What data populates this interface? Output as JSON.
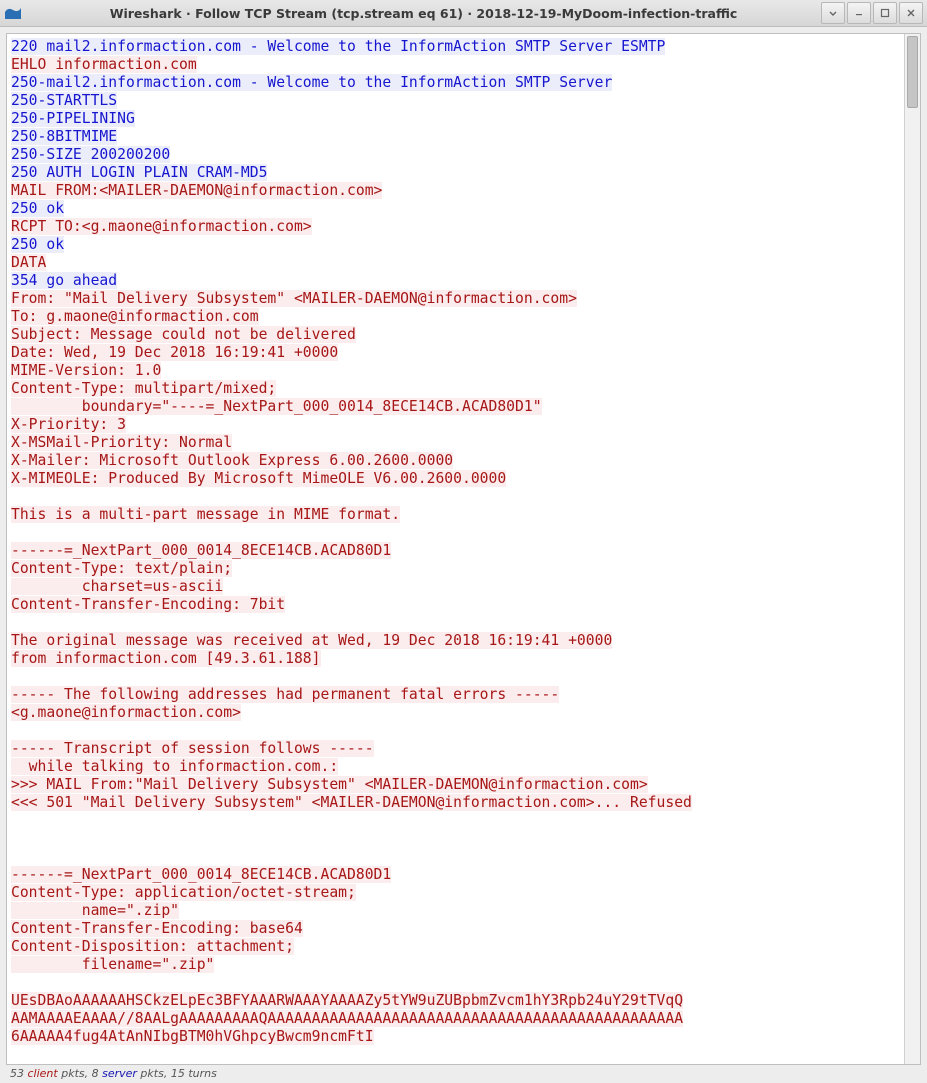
{
  "window": {
    "title": "Wireshark · Follow TCP Stream (tcp.stream eq 61) · 2018-12-19-MyDoom-infection-traffic"
  },
  "status": {
    "client_pkts": "53",
    "client_word": "client",
    "mid1": " pkts, ",
    "server_pkts": "8",
    "server_word": "server",
    "mid2": " pkts, ",
    "turns": "15 turns"
  },
  "stream": [
    {
      "dir": "server",
      "text": "220 mail2.informaction.com - Welcome to the InformAction SMTP Server ESMTP"
    },
    {
      "dir": "client",
      "text": "EHLO informaction.com"
    },
    {
      "dir": "server",
      "text": "250-mail2.informaction.com - Welcome to the InformAction SMTP Server"
    },
    {
      "dir": "server",
      "text": "250-STARTTLS"
    },
    {
      "dir": "server",
      "text": "250-PIPELINING"
    },
    {
      "dir": "server",
      "text": "250-8BITMIME"
    },
    {
      "dir": "server",
      "text": "250-SIZE 200200200"
    },
    {
      "dir": "server",
      "text": "250 AUTH LOGIN PLAIN CRAM-MD5"
    },
    {
      "dir": "client",
      "text": "MAIL FROM:<MAILER-DAEMON@informaction.com>"
    },
    {
      "dir": "server",
      "text": "250 ok"
    },
    {
      "dir": "client",
      "text": "RCPT TO:<g.maone@informaction.com>"
    },
    {
      "dir": "server",
      "text": "250 ok"
    },
    {
      "dir": "client",
      "text": "DATA"
    },
    {
      "dir": "server",
      "text": "354 go ahead"
    },
    {
      "dir": "client",
      "text": "From: \"Mail Delivery Subsystem\" <MAILER-DAEMON@informaction.com>"
    },
    {
      "dir": "client",
      "text": "To: g.maone@informaction.com"
    },
    {
      "dir": "client",
      "text": "Subject: Message could not be delivered"
    },
    {
      "dir": "client",
      "text": "Date: Wed, 19 Dec 2018 16:19:41 +0000"
    },
    {
      "dir": "client",
      "text": "MIME-Version: 1.0"
    },
    {
      "dir": "client",
      "text": "Content-Type: multipart/mixed;"
    },
    {
      "dir": "client",
      "text": "        boundary=\"----=_NextPart_000_0014_8ECE14CB.ACAD80D1\""
    },
    {
      "dir": "client",
      "text": "X-Priority: 3"
    },
    {
      "dir": "client",
      "text": "X-MSMail-Priority: Normal"
    },
    {
      "dir": "client",
      "text": "X-Mailer: Microsoft Outlook Express 6.00.2600.0000"
    },
    {
      "dir": "client",
      "text": "X-MIMEOLE: Produced By Microsoft MimeOLE V6.00.2600.0000"
    },
    {
      "dir": "client",
      "text": ""
    },
    {
      "dir": "client",
      "text": "This is a multi-part message in MIME format."
    },
    {
      "dir": "client",
      "text": ""
    },
    {
      "dir": "client",
      "text": "------=_NextPart_000_0014_8ECE14CB.ACAD80D1"
    },
    {
      "dir": "client",
      "text": "Content-Type: text/plain;"
    },
    {
      "dir": "client",
      "text": "        charset=us-ascii"
    },
    {
      "dir": "client",
      "text": "Content-Transfer-Encoding: 7bit"
    },
    {
      "dir": "client",
      "text": ""
    },
    {
      "dir": "client",
      "text": "The original message was received at Wed, 19 Dec 2018 16:19:41 +0000"
    },
    {
      "dir": "client",
      "text": "from informaction.com [49.3.61.188]"
    },
    {
      "dir": "client",
      "text": ""
    },
    {
      "dir": "client",
      "text": "----- The following addresses had permanent fatal errors -----"
    },
    {
      "dir": "client",
      "text": "<g.maone@informaction.com>"
    },
    {
      "dir": "client",
      "text": ""
    },
    {
      "dir": "client",
      "text": "----- Transcript of session follows -----"
    },
    {
      "dir": "client",
      "text": "  while talking to informaction.com.:"
    },
    {
      "dir": "client",
      "text": ">>> MAIL From:\"Mail Delivery Subsystem\" <MAILER-DAEMON@informaction.com>"
    },
    {
      "dir": "client",
      "text": "<<< 501 \"Mail Delivery Subsystem\" <MAILER-DAEMON@informaction.com>... Refused"
    },
    {
      "dir": "client",
      "text": ""
    },
    {
      "dir": "client",
      "text": ""
    },
    {
      "dir": "client",
      "text": ""
    },
    {
      "dir": "client",
      "text": "------=_NextPart_000_0014_8ECE14CB.ACAD80D1"
    },
    {
      "dir": "client",
      "text": "Content-Type: application/octet-stream;"
    },
    {
      "dir": "client",
      "text": "        name=\".zip\""
    },
    {
      "dir": "client",
      "text": "Content-Transfer-Encoding: base64"
    },
    {
      "dir": "client",
      "text": "Content-Disposition: attachment;"
    },
    {
      "dir": "client",
      "text": "        filename=\".zip\""
    },
    {
      "dir": "client",
      "text": ""
    },
    {
      "dir": "client",
      "text": "UEsDBAoAAAAAAHSCkzELpEc3BFYAAARWAAAYAAAAZy5tYW9uZUBpbmZvcm1hY3Rpb24uY29tTVqQ"
    },
    {
      "dir": "client",
      "text": "AAMAAAAEAAAA//8AALgAAAAAAAAAQAAAAAAAAAAAAAAAAAAAAAAAAAAAAAAAAAAAAAAAAAAAAAAA"
    },
    {
      "dir": "client",
      "text": "6AAAAA4fug4AtAnNIbgBTM0hVGhpcyBwcm9ncmFtI"
    }
  ]
}
